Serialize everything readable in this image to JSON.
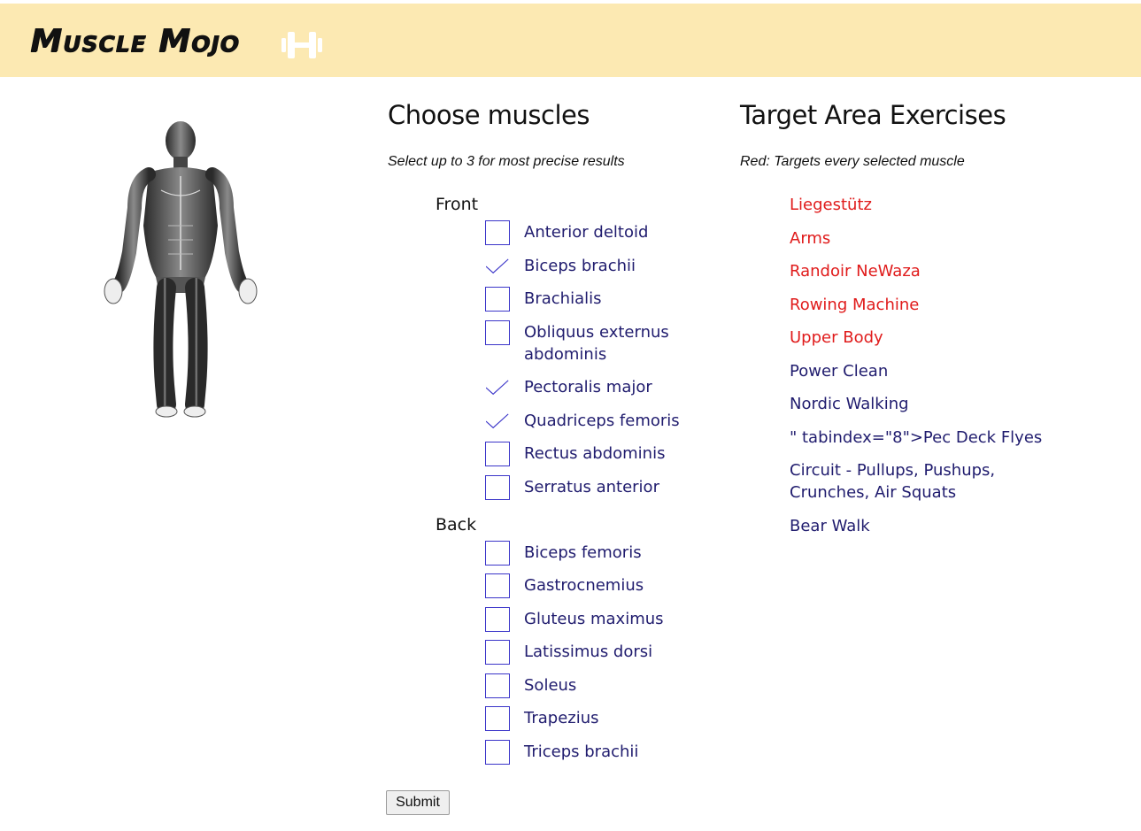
{
  "brand": {
    "title": "Muscle Mojo",
    "icon": "dumbbell-icon"
  },
  "muscles_panel": {
    "heading": "Choose muscles",
    "subtitle": "Select up to 3 for most precise results",
    "front": {
      "label": "Front",
      "items": [
        {
          "label": "Anterior deltoid",
          "checked": false
        },
        {
          "label": "Biceps brachii",
          "checked": true
        },
        {
          "label": "Brachialis",
          "checked": false
        },
        {
          "label": "Obliquus externus abdominis",
          "checked": false
        },
        {
          "label": "Pectoralis major",
          "checked": true
        },
        {
          "label": "Quadriceps femoris",
          "checked": true
        },
        {
          "label": "Rectus abdominis",
          "checked": false
        },
        {
          "label": "Serratus anterior",
          "checked": false
        }
      ]
    },
    "back": {
      "label": "Back",
      "items": [
        {
          "label": "Biceps femoris",
          "checked": false
        },
        {
          "label": "Gastrocnemius",
          "checked": false
        },
        {
          "label": "Gluteus maximus",
          "checked": false
        },
        {
          "label": "Latissimus dorsi",
          "checked": false
        },
        {
          "label": "Soleus",
          "checked": false
        },
        {
          "label": "Trapezius",
          "checked": false
        },
        {
          "label": "Triceps brachii",
          "checked": false
        }
      ]
    },
    "submit_label": "Submit"
  },
  "exercises_panel": {
    "heading": "Target Area Exercises",
    "subtitle": "Red: Targets every selected muscle",
    "items": [
      {
        "label": "Liegestütz",
        "all_targets": true
      },
      {
        "label": "Arms",
        "all_targets": true
      },
      {
        "label": "Randoir NeWaza",
        "all_targets": true
      },
      {
        "label": "Rowing Machine",
        "all_targets": true
      },
      {
        "label": "Upper Body",
        "all_targets": true
      },
      {
        "label": "Power Clean",
        "all_targets": false
      },
      {
        "label": "Nordic Walking",
        "all_targets": false
      },
      {
        "label": "\" tabindex=\"8\">Pec Deck Flyes",
        "all_targets": false
      },
      {
        "label": "Circuit - Pullups, Pushups, Crunches, Air Squats",
        "all_targets": false
      },
      {
        "label": "Bear Walk",
        "all_targets": false
      }
    ]
  },
  "colors": {
    "header_bg": "#fce9b2",
    "accent": "#3b35c9",
    "link_text": "#201c6e",
    "highlight": "#e01b1b"
  }
}
